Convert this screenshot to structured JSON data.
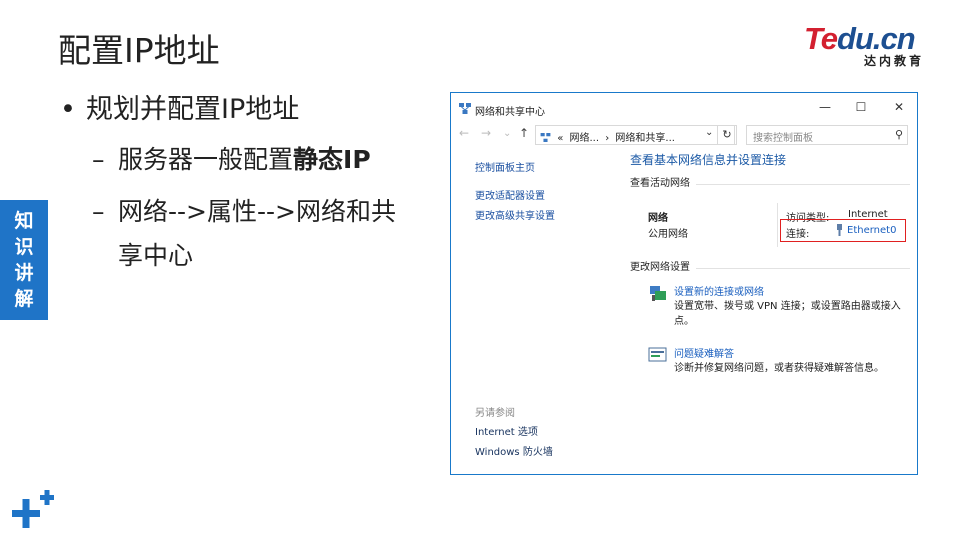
{
  "slide": {
    "title": "配置IP地址",
    "bullet": "规划并配置IP地址",
    "sub1_prefix": "服务器一般配置",
    "sub1_bold": "静态IP",
    "sub2_line1": "网络-->属性-->网络和共",
    "sub2_line2": "享中心",
    "dash": "–",
    "side_tab": [
      "知",
      "识",
      "讲",
      "解"
    ]
  },
  "logo": {
    "main_red": "Te",
    "main_blue": "du.cn",
    "sub": "达内教育"
  },
  "window": {
    "title": "网络和共享中心",
    "controls": {
      "minimize": "—",
      "maximize": "☐",
      "close": "✕"
    },
    "nav": {
      "back": "←",
      "forward": "→",
      "recent": "⌄",
      "up": "↑"
    },
    "breadcrumb": {
      "prefix": "«",
      "item1": "网络...",
      "sep": "›",
      "item2": "网络和共享..."
    },
    "search_placeholder": "搜索控制面板",
    "left_links": [
      "控制面板主页",
      "更改适配器设置",
      "更改高级共享设置"
    ],
    "see_also": {
      "header": "另请参阅",
      "items": [
        "Internet 选项",
        "Windows 防火墙"
      ]
    },
    "main_title": "查看基本网络信息并设置连接",
    "active_header": "查看活动网络",
    "network": {
      "name": "网络",
      "category": "公用网络",
      "access_label": "访问类型:",
      "access_value": "Internet",
      "conn_label": "连接:",
      "conn_value": "Ethernet0"
    },
    "change_header": "更改网络设置",
    "tasks": [
      {
        "link": "设置新的连接或网络",
        "desc": "设置宽带、拨号或 VPN 连接；或设置路由器或接入点。"
      },
      {
        "link": "问题疑难解答",
        "desc": "诊断并修复网络问题，或者获得疑难解答信息。"
      }
    ]
  },
  "colors": {
    "accent_blue": "#1f74c7",
    "link_blue": "#1a5fbf",
    "highlight_red": "#e02020",
    "logo_red": "#d32030",
    "logo_blue": "#1d4f91"
  }
}
